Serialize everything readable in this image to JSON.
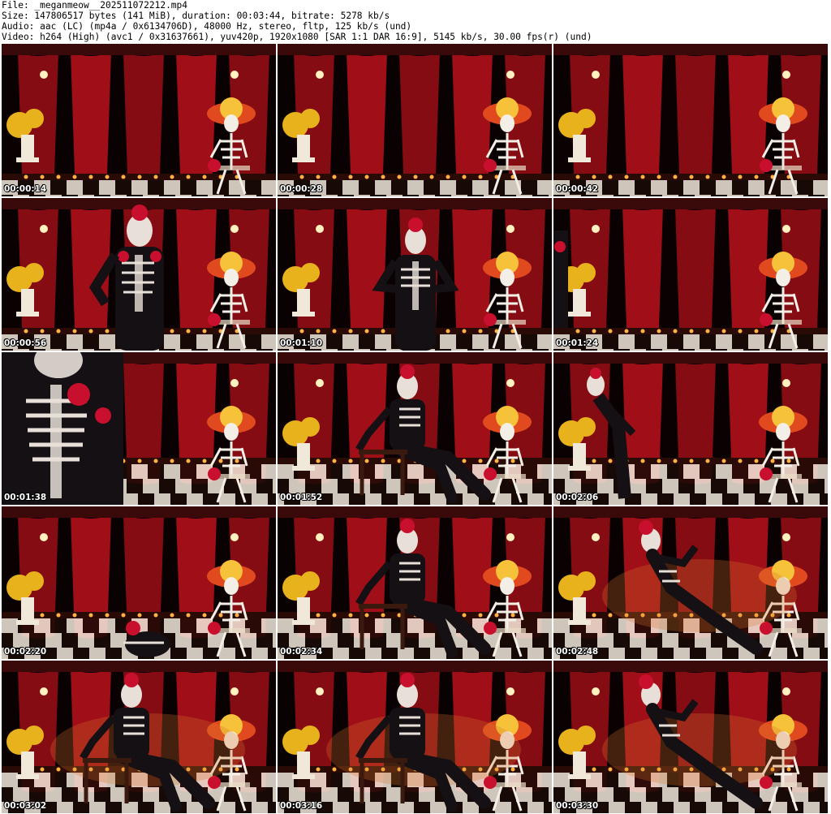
{
  "header": {
    "file": "File: _meganmeow__202511072212.mp4",
    "size": "Size: 147806517 bytes (141 MiB), duration: 00:03:44, bitrate: 5278 kb/s",
    "audio": "Audio: aac (LC) (mp4a / 0x6134706D), 48000 Hz, stereo, fltp, 125 kb/s (und)",
    "video": "Video: h264 (High) (avc1 / 0x31637661), yuv420p, 1920x1080 [SAR 1:1 DAR 16:9], 5145 kb/s, 30.00 fps(r) (und)"
  },
  "thumbnails": [
    {
      "timestamp": "00:00:14",
      "figure": "none"
    },
    {
      "timestamp": "00:00:28",
      "figure": "none"
    },
    {
      "timestamp": "00:00:42",
      "figure": "none"
    },
    {
      "timestamp": "00:00:56",
      "figure": "standing-left"
    },
    {
      "timestamp": "00:01:10",
      "figure": "standing-center"
    },
    {
      "timestamp": "00:01:24",
      "figure": "edge-left"
    },
    {
      "timestamp": "00:01:38",
      "figure": "closeup"
    },
    {
      "timestamp": "00:01:52",
      "figure": "sitting"
    },
    {
      "timestamp": "00:02:06",
      "figure": "bending"
    },
    {
      "timestamp": "00:02:20",
      "figure": "kneeling"
    },
    {
      "timestamp": "00:02:34",
      "figure": "sitting"
    },
    {
      "timestamp": "00:02:48",
      "figure": "reclining"
    },
    {
      "timestamp": "00:03:02",
      "figure": "sitting"
    },
    {
      "timestamp": "00:03:16",
      "figure": "sitting"
    },
    {
      "timestamp": "00:03:30",
      "figure": "reclining"
    }
  ],
  "colors": {
    "curtain_red": "#b0101a",
    "curtain_dark": "#0a0103",
    "floor_light": "#f2e9dc",
    "floor_dark": "#1a0a06",
    "candle": "#ffb347",
    "sombrero": "#e14a1e",
    "marigold": "#e8b21c"
  }
}
